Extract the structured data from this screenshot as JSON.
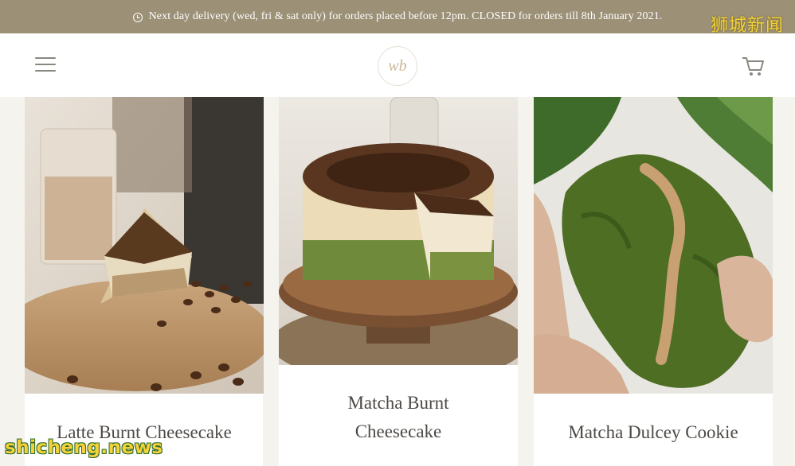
{
  "announcement": {
    "icon": "clock-icon",
    "text": "Next day delivery (wed, fri & sat only) for orders placed before 12pm. CLOSED for orders till 8th January 2021."
  },
  "watermarks": {
    "top": "狮城新闻",
    "bottom": "shicheng.news"
  },
  "header": {
    "menu_icon": "hamburger-menu-icon",
    "logo_text": "wb",
    "cart_icon": "cart-icon"
  },
  "products": [
    {
      "title": "Latte Burnt Cheesecake"
    },
    {
      "title_line1": "Matcha Burnt",
      "title_line2": "Cheesecake"
    },
    {
      "title": "Matcha Dulcey Cookie"
    }
  ],
  "colors": {
    "announcement_bg": "#9c9077",
    "page_bg": "#f5f3ee",
    "title_text": "#4d4a45",
    "watermark": "#f4d23a"
  }
}
